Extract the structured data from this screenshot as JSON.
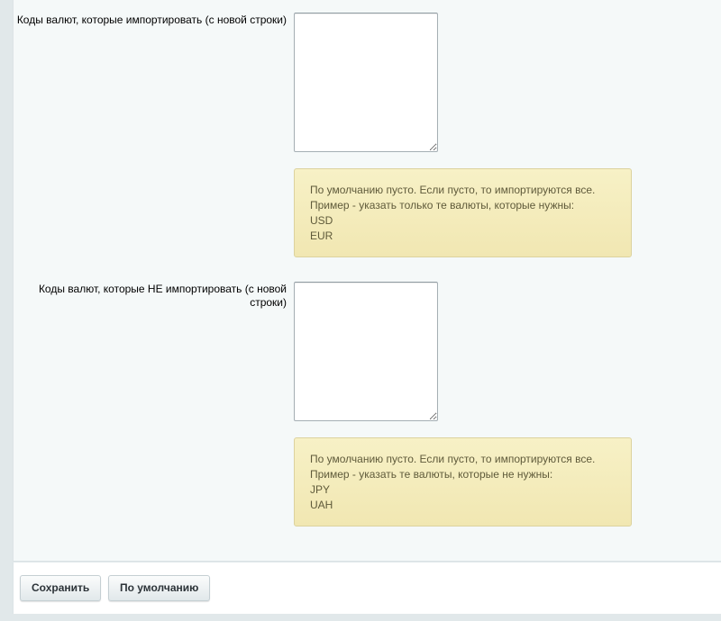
{
  "fields": [
    {
      "label": "Коды валют, которые импортировать (с новой строки)",
      "value": "",
      "hint": [
        "По умолчанию пусто. Если пусто, то импортируются все.",
        "Пример - указать только те валюты, которые нужны:",
        "USD",
        "EUR"
      ]
    },
    {
      "label": "Коды валют, которые НЕ импортировать (с новой строки)",
      "value": "",
      "hint": [
        "По умолчанию пусто. Если пусто, то импортируются все.",
        "Пример - указать те валюты, которые не нужны:",
        "JPY",
        "UAH"
      ]
    }
  ],
  "buttons": {
    "save_label": "Сохранить",
    "default_label": "По умолчанию"
  },
  "colors": {
    "hint_background": "#f5eebe",
    "hint_border": "#dcd29e",
    "hint_text": "#5f5a3a",
    "panel_background": "#f5f9f9"
  }
}
